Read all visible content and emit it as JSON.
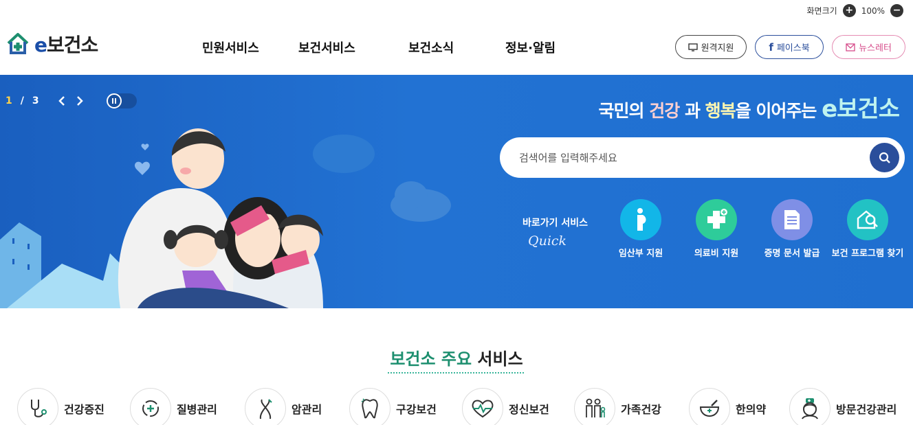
{
  "util": {
    "zoom_label": "화면크기",
    "zoom_value": "100%",
    "zoom_in": "+",
    "zoom_out": "−"
  },
  "logo": {
    "prefix": "e",
    "text": "보건소"
  },
  "gnb": [
    "민원서비스",
    "보건서비스",
    "보건소식",
    "정보·알림"
  ],
  "sns": {
    "remote": "원격지원",
    "facebook": "페이스북",
    "newsletter": "뉴스레터"
  },
  "hero": {
    "pager_current": "1",
    "pager_sep": "/",
    "pager_total": "3",
    "slogan": {
      "p1": "국민의 ",
      "hl1": "건강",
      "p2": " 과 ",
      "hl2": "행복",
      "p3": "을 이어주는 ",
      "brand": "e보건소"
    },
    "search_placeholder": "검색어를 입력해주세요",
    "quick_label": "바로가기 서비스",
    "quick_sub": "Quick",
    "quick_items": [
      "임산부 지원",
      "의료비 지원",
      "증명 문서 발급",
      "보건 프로그램 찾기"
    ]
  },
  "section": {
    "title_green": "보건소 주요",
    "title_dark": " 서비스"
  },
  "services": [
    "건강증진",
    "질병관리",
    "암관리",
    "구강보건",
    "정신보건",
    "가족건강",
    "한의약",
    "방문건강관리"
  ],
  "colors": {
    "hero": "#1f6fd0",
    "brand_green": "#1d8f6f",
    "search_btn": "#2a4e9b"
  }
}
